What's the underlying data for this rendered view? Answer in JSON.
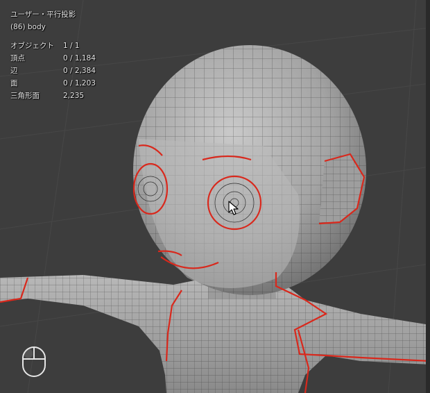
{
  "viewport": {
    "view_name": "ユーザー・平行投影",
    "object_info": "(86) body",
    "stats": [
      {
        "label": "オブジェクト",
        "value": "1 / 1"
      },
      {
        "label": "頂点",
        "value": "0 / 1,184"
      },
      {
        "label": "辺",
        "value": "0 / 2,384"
      },
      {
        "label": "面",
        "value": "0 / 1,203"
      },
      {
        "label": "三角形面",
        "value": "2,235"
      }
    ]
  },
  "colors": {
    "background": "#3d3d3d",
    "grid": "#4a4a4a",
    "mesh_fill": "#a9a9a9",
    "mesh_wire": "#2b2b2b",
    "seam": "#d9281c"
  },
  "icons": {
    "mouse": "mouse-icon",
    "cursor": "arrow-cursor-icon"
  }
}
